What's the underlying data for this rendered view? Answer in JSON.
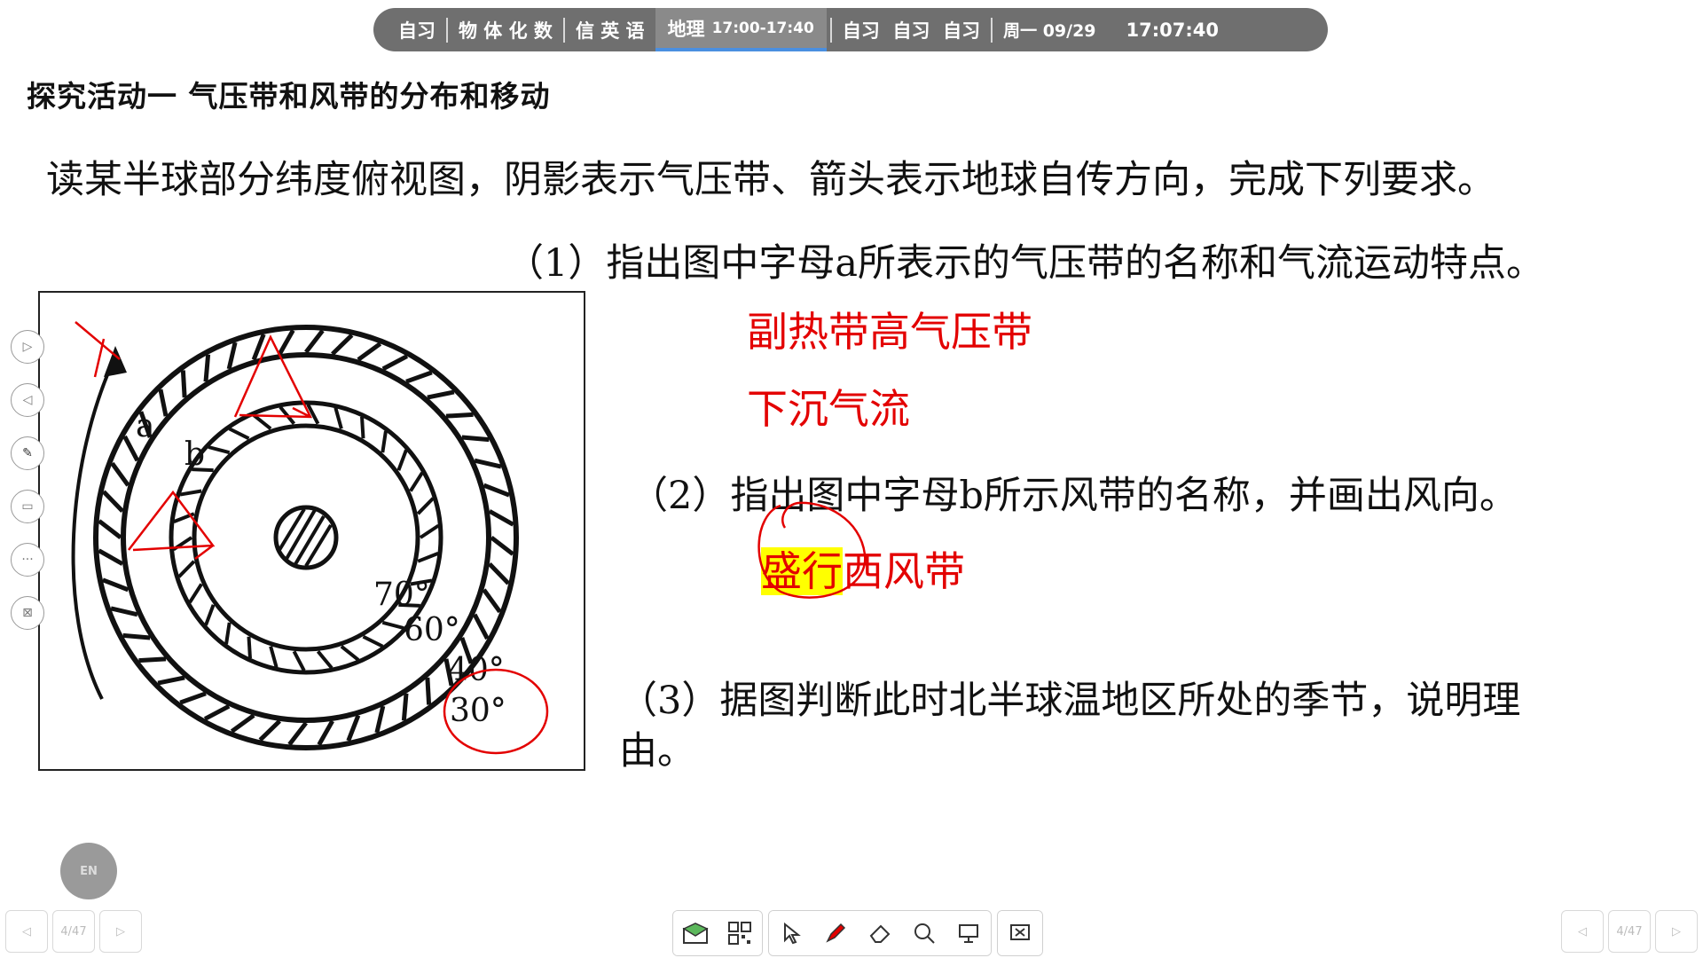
{
  "schedule": {
    "items": [
      "自习",
      "物 体 化 数",
      "信 英 语"
    ],
    "active_subject": "地理",
    "active_time": "17:00-17:40",
    "after": "自习  自习  自习",
    "date": "周一 09/29",
    "clock": "17:07:40"
  },
  "slide": {
    "heading": "探究活动一  气压带和风带的分布和移动",
    "intro": "读某半球部分纬度俯视图，阴影表示气压带、箭头表示地球自传方向，完成下列要求。",
    "q1": "（1）指出图中字母a所表示的气压带的名称和气流运动特点。",
    "q2": "（2）指出图中字母b所示风带的名称，并画出风向。",
    "q3_line1": "（3）据图判断此时北半球温地区所处的季节，说明理",
    "q3_line2": "由。",
    "answers": {
      "a1": "副热带高气压带",
      "a2": "下沉气流",
      "b_highlight": "盛行",
      "b_rest": "西风带"
    },
    "figure_labels": {
      "a": "a",
      "b": "b",
      "lat70": "70°",
      "lat60": "60°",
      "lat40": "40°",
      "lat30": "30°"
    }
  },
  "pager": {
    "left": "4/47",
    "right": "4/47"
  },
  "colors": {
    "annotation_red": "#e30000",
    "highlight": "#ffff00",
    "bar_bg": "#6f6f6f"
  }
}
